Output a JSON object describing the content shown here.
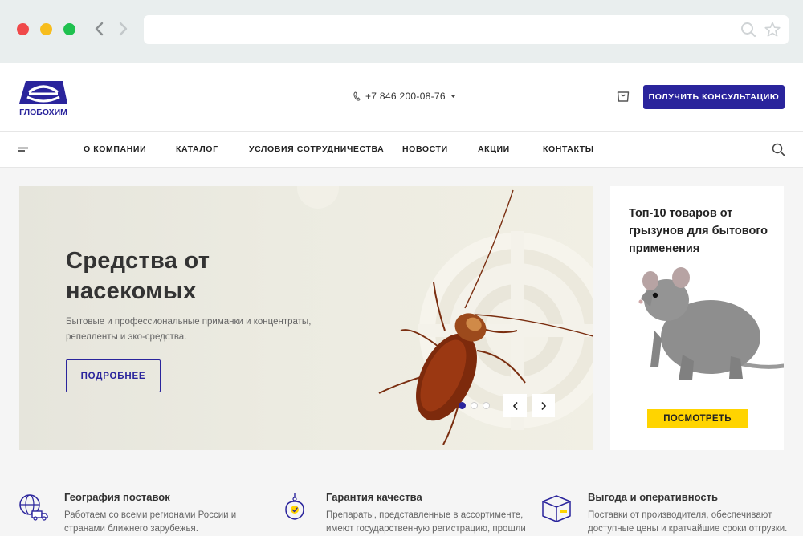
{
  "browser": {
    "url": "",
    "icons": [
      "back-arrow-icon",
      "forward-arrow-icon",
      "search-icon",
      "star-icon"
    ]
  },
  "header": {
    "logo_text": "ГЛОБОХИМ",
    "phone": "+7 846 200-08-76",
    "consult_label": "ПОЛУЧИТЬ КОНСУЛЬТАЦИЮ"
  },
  "nav": {
    "items": [
      {
        "label": "О КОМПАНИИ"
      },
      {
        "label": "КАТАЛОГ"
      },
      {
        "label": "УСЛОВИЯ СОТРУДНИЧЕСТВА"
      },
      {
        "label": "НОВОСТИ"
      },
      {
        "label": "АКЦИИ"
      },
      {
        "label": "КОНТАКТЫ"
      }
    ]
  },
  "banner": {
    "title_line1": "Средства от",
    "title_line2": "насекомых",
    "text": "Бытовые и профессиональные приманки и концентраты, репелленты и эко-средства.",
    "button_label": "ПОДРОБНЕЕ",
    "active_slide": 1,
    "slide_count": 3
  },
  "promo": {
    "title": "Топ-10 товаров от грызунов для бытового применения",
    "button_label": "ПОСМОТРЕТЬ"
  },
  "features": [
    {
      "title": "География поставок",
      "text": "Работаем со всеми регионами России и странами ближнего зарубежья.",
      "icon": "globe-truck-icon"
    },
    {
      "title": "Гарантия качества",
      "text": "Препараты, представленные в ассортименте, имеют государственную регистрацию, прошли",
      "icon": "quality-badge-icon"
    },
    {
      "title": "Выгода и оперативность",
      "text": "Поставки от производителя, обеспечивают доступные цены и кратчайшие сроки отгрузки.",
      "icon": "box-icon"
    }
  ],
  "colors": {
    "brand_blue": "#2a249c",
    "promo_yellow": "#ffd400"
  }
}
